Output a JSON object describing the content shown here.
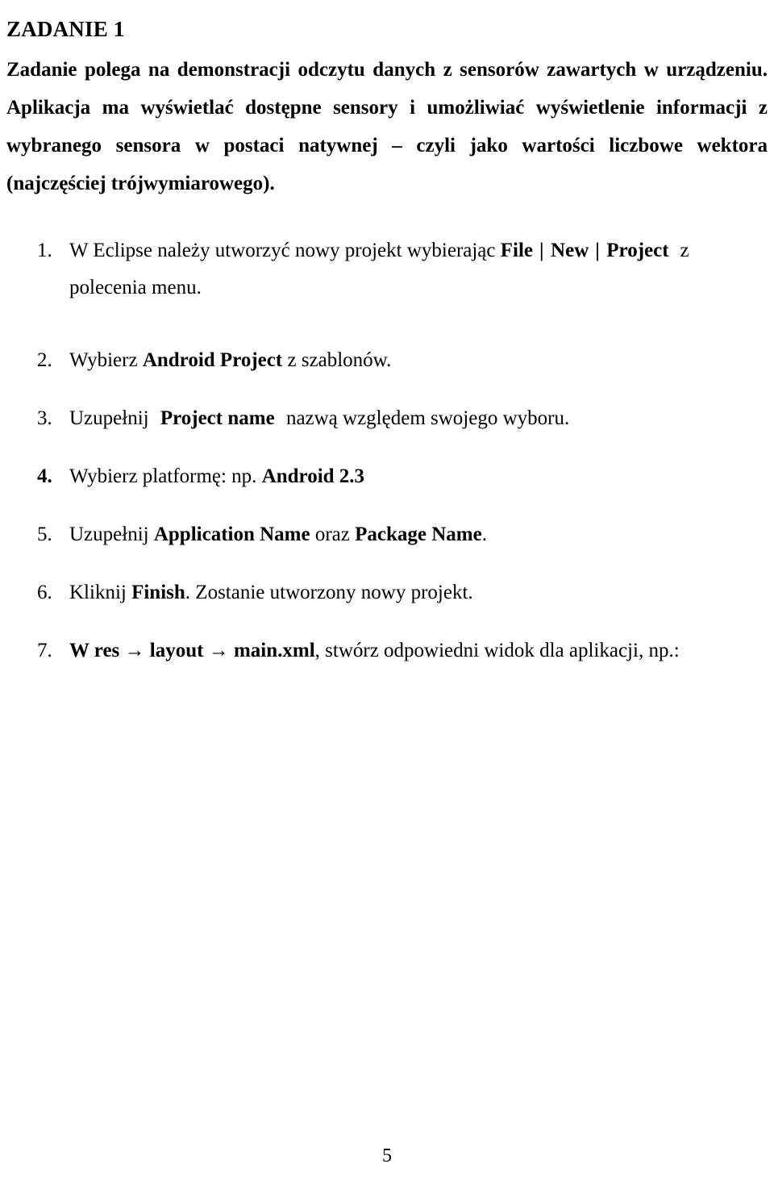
{
  "document": {
    "title": "ZADANIE 1",
    "language": "Polish",
    "page_number": "5",
    "intro": {
      "full_text": "Zadanie polega na demonstracji odczytu danych z sensorów zawartych w urządzeniu. Aplikacja ma wyświetlać dostępne sensory i umożliwiać wyświetlenie informacji z wybranego sensora w postaci natywnej – czyli jako wartości liczbowe wektora (najczęściej trójwymiarowego)."
    },
    "steps": [
      {
        "number": "1.",
        "number_bold": false,
        "text_before": "W Eclipse należy utworzyć nowy projekt wybierając ",
        "bold_1": "File",
        "separator_1": "|",
        "bold_2": "New",
        "separator_2": "|",
        "bold_3": "Project",
        "text_after": "z",
        "line_2": "polecenia menu."
      },
      {
        "number": "2.",
        "number_bold": false,
        "text_before": "Wybierz ",
        "bold_1": "Android Project",
        "text_after": " z szablonów."
      },
      {
        "number": "3.",
        "number_bold": false,
        "text_before": "Uzupełnij ",
        "bold_1": "Project name",
        "text_after": " nazwą względem swojego wyboru."
      },
      {
        "number": "4.",
        "number_bold": true,
        "text_before": "Wybierz platformę: np. ",
        "bold_1": "Android 2.3",
        "text_after": ""
      },
      {
        "number": "5.",
        "number_bold": false,
        "text_before": "Uzupełnij ",
        "bold_1": "Application Name",
        "text_middle": " oraz ",
        "bold_2": "Package Name",
        "text_after": "."
      },
      {
        "number": "6.",
        "number_bold": false,
        "text_before": "Kliknij ",
        "bold_1": "Finish",
        "text_after": ". Zostanie utworzony nowy projekt."
      },
      {
        "number": "7.",
        "number_bold": false,
        "bold_1": "W res → layout → main.xml",
        "text_after": ", stwórz odpowiedni widok dla aplikacji, np.:"
      }
    ]
  }
}
